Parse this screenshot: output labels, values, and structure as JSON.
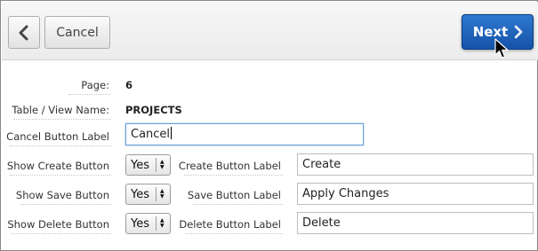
{
  "toolbar": {
    "cancel_label": "Cancel",
    "next_label": "Next"
  },
  "form": {
    "page": {
      "label": "Page:",
      "value": "6"
    },
    "table_view": {
      "label": "Table / View Name:",
      "value": "PROJECTS"
    },
    "cancel_button_label": {
      "label": "Cancel Button Label",
      "value": "Cancel"
    },
    "show_create": {
      "label": "Show Create Button",
      "selected": "Yes"
    },
    "create_label": {
      "label": "Create Button Label",
      "value": "Create"
    },
    "show_save": {
      "label": "Show Save Button",
      "selected": "Yes"
    },
    "save_label": {
      "label": "Save Button Label",
      "value": "Apply Changes"
    },
    "show_delete": {
      "label": "Show Delete Button",
      "selected": "Yes"
    },
    "delete_label": {
      "label": "Delete Button Label",
      "value": "Delete"
    }
  },
  "colors": {
    "next_button": "#1f62b8",
    "focus_border": "#6a9fd8"
  },
  "icons": {
    "back": "chevron-left-icon",
    "next": "chevron-right-icon",
    "select_arrows": "up-down-arrows-icon",
    "cursor": "mouse-pointer-icon"
  }
}
